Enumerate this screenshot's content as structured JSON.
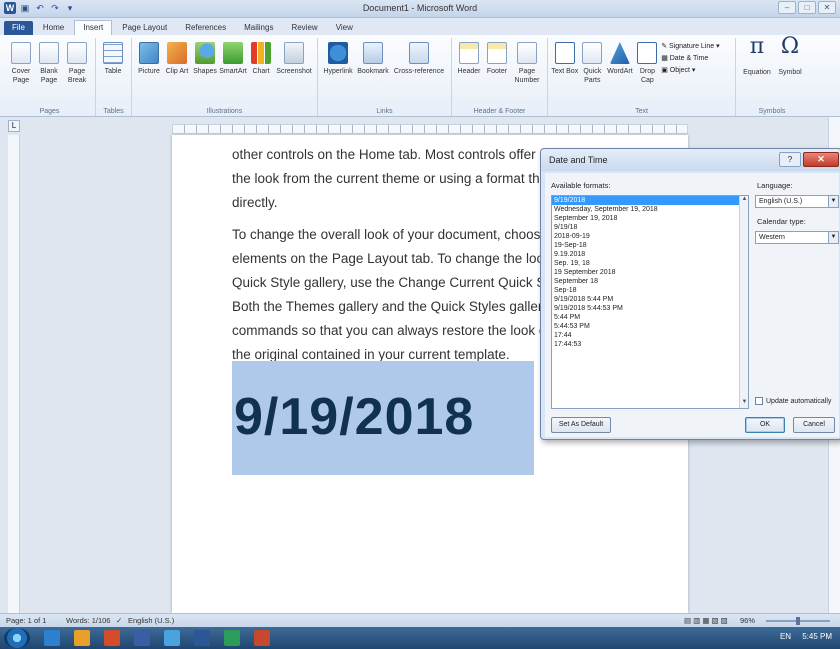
{
  "window": {
    "title": "Document1 - Microsoft Word"
  },
  "ribbon_tabs": [
    "File",
    "Home",
    "Insert",
    "Page Layout",
    "References",
    "Mailings",
    "Review",
    "View"
  ],
  "ribbon": {
    "pages": {
      "label": "Pages",
      "cover": "Cover Page",
      "blank": "Blank Page",
      "break": "Page Break"
    },
    "tables": {
      "label": "Tables",
      "table": "Table"
    },
    "illustrations": {
      "label": "Illustrations",
      "picture": "Picture",
      "clipart": "Clip Art",
      "shapes": "Shapes",
      "smartart": "SmartArt",
      "chart": "Chart",
      "screenshot": "Screenshot"
    },
    "links": {
      "label": "Links",
      "hyperlink": "Hyperlink",
      "bookmark": "Bookmark",
      "xref": "Cross-reference"
    },
    "header_footer": {
      "label": "Header & Footer",
      "header": "Header",
      "footer": "Footer",
      "page_number": "Page Number"
    },
    "text": {
      "label": "Text",
      "textbox": "Text Box",
      "quickparts": "Quick Parts",
      "wordart": "WordArt",
      "dropcap": "Drop Cap",
      "signature": "Signature Line",
      "datetime": "Date & Time",
      "object": "Object"
    },
    "symbols": {
      "label": "Symbols",
      "equation": "Equation",
      "symbol": "Symbol",
      "equation_glyph": "π",
      "symbol_glyph": "Ω"
    }
  },
  "document": {
    "lines": [
      "other controls on the Home tab. Most controls offer a choice of using",
      "the look from the current theme or using a format that you specify",
      "directly."
    ],
    "paragraph2": [
      "To change the overall look of your document, choose new Theme",
      "elements on the Page Layout tab. To change the looks available in the",
      "Quick Style gallery, use the Change Current Quick Style Set command.",
      "Both the Themes gallery and the Quick Styles gallery provide reset",
      "commands so that you can always restore the look of your document to",
      "the original contained in your current template."
    ],
    "inserted_date": "9/19/2018"
  },
  "dialog": {
    "title": "Date and Time",
    "formats_label": "Available formats:",
    "formats": [
      "9/19/2018",
      "Wednesday, September 19, 2018",
      "September 19, 2018",
      "9/19/18",
      "2018-09-19",
      "19-Sep-18",
      "9.19.2018",
      "Sep. 19, 18",
      "19 September 2018",
      "September 18",
      "Sep-18",
      "9/19/2018 5:44 PM",
      "9/19/2018 5:44:53 PM",
      "5:44 PM",
      "5:44:53 PM",
      "17:44",
      "17:44:53"
    ],
    "selected_index": 0,
    "language_label": "Language:",
    "language_value": "English (U.S.)",
    "calendar_label": "Calendar type:",
    "calendar_value": "Western",
    "update_label": "Update automatically",
    "set_default": "Set As Default",
    "ok": "OK",
    "cancel": "Cancel"
  },
  "status": {
    "page": "Page: 1 of 1",
    "words": "Words: 1/106",
    "language": "English (U.S.)",
    "zoom": "96%"
  },
  "taskbar": {
    "lang": "EN",
    "time": "5:45 PM"
  }
}
